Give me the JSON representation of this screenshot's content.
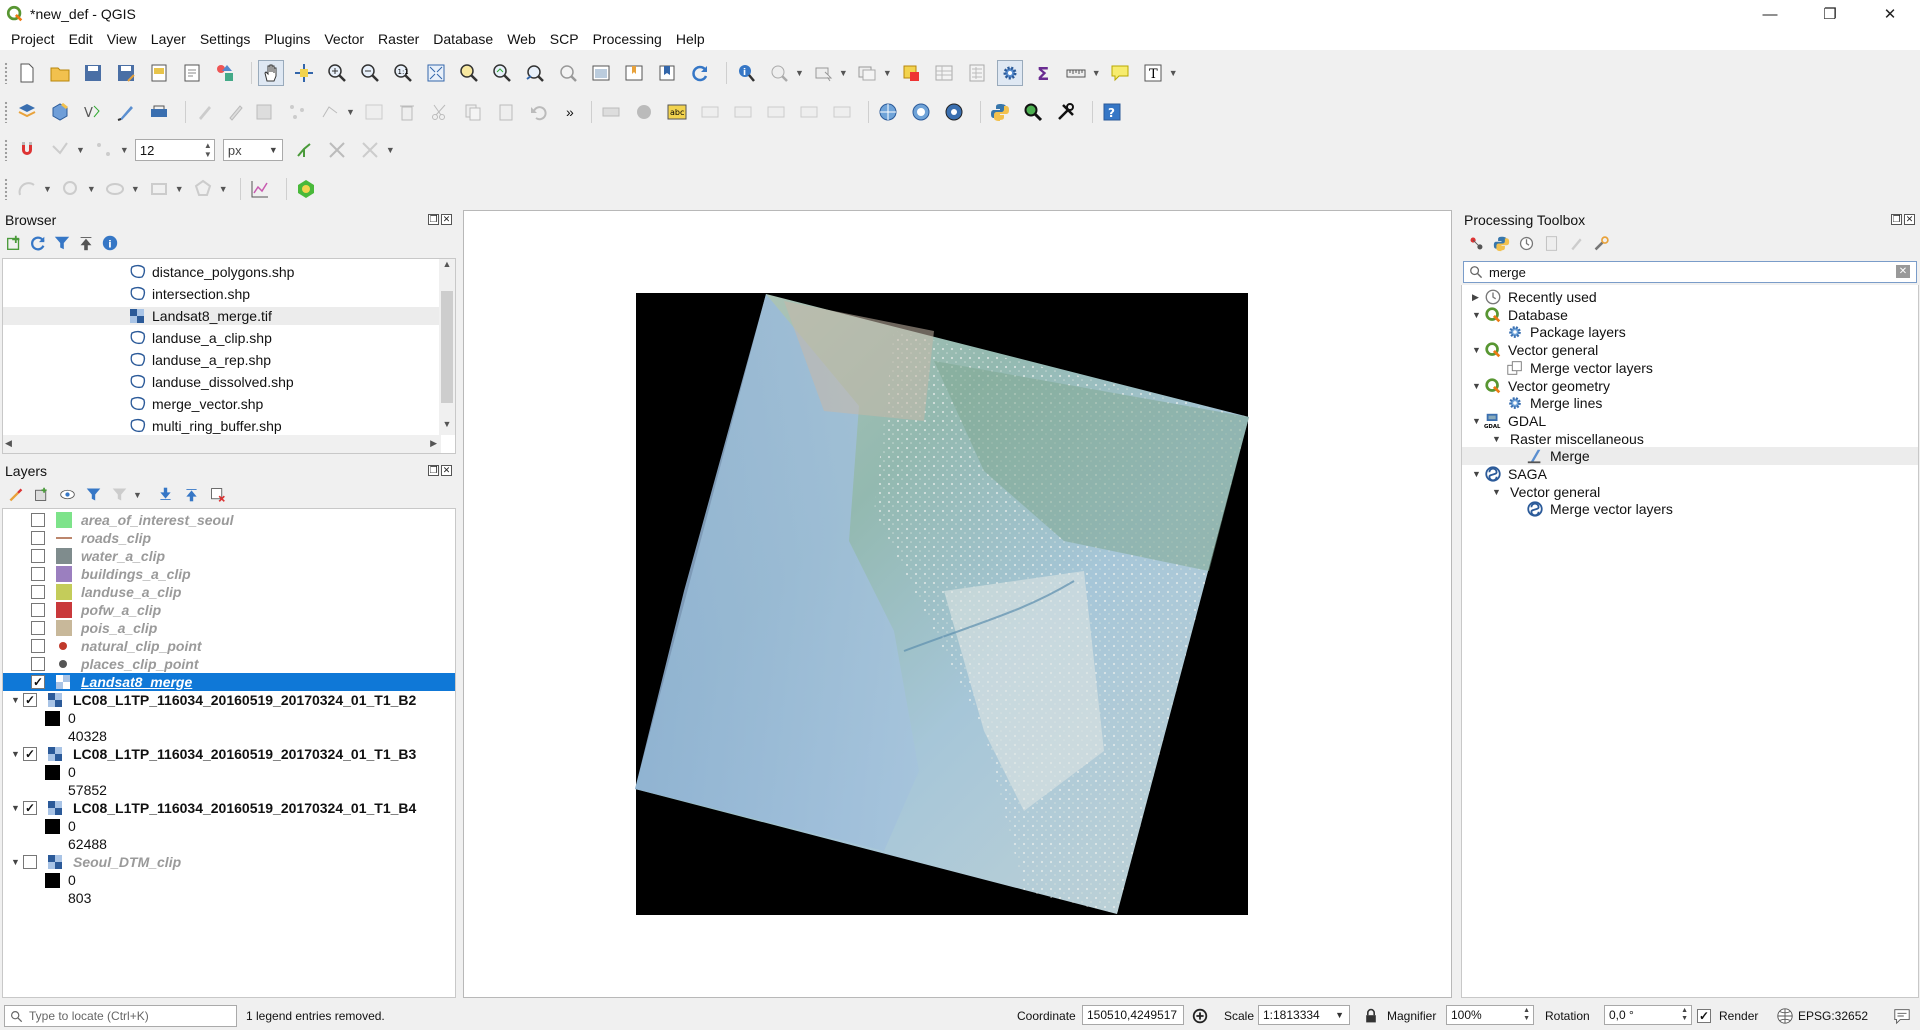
{
  "window": {
    "title": "*new_def - QGIS",
    "min": "—",
    "max": "❐",
    "close": "✕"
  },
  "menu": [
    "Project",
    "Edit",
    "View",
    "Layer",
    "Settings",
    "Plugins",
    "Vector",
    "Raster",
    "Database",
    "Web",
    "SCP",
    "Processing",
    "Help"
  ],
  "digitize": {
    "value": "12",
    "unit": "px"
  },
  "browser": {
    "title": "Browser",
    "items": [
      {
        "label": "distance_polygons.shp",
        "type": "vector"
      },
      {
        "label": "intersection.shp",
        "type": "vector"
      },
      {
        "label": "Landsat8_merge.tif",
        "type": "raster"
      },
      {
        "label": "landuse_a_clip.shp",
        "type": "vector"
      },
      {
        "label": "landuse_a_rep.shp",
        "type": "vector"
      },
      {
        "label": "landuse_dissolved.shp",
        "type": "vector"
      },
      {
        "label": "merge_vector.shp",
        "type": "vector"
      },
      {
        "label": "multi_ring_buffer.shp",
        "type": "vector"
      }
    ]
  },
  "layers": {
    "title": "Layers",
    "items": [
      {
        "name": "area_of_interest_seoul",
        "checked": false,
        "swatch": "#7de38a"
      },
      {
        "name": "roads_clip",
        "checked": false,
        "swatch": "line:#a0522d"
      },
      {
        "name": "water_a_clip",
        "checked": false,
        "swatch": "#7f8c8d"
      },
      {
        "name": "buildings_a_clip",
        "checked": false,
        "swatch": "#9b7fbf"
      },
      {
        "name": "landuse_a_clip",
        "checked": false,
        "swatch": "#c4cc5a"
      },
      {
        "name": "pofw_a_clip",
        "checked": false,
        "swatch": "#c9393b"
      },
      {
        "name": "pois_a_clip",
        "checked": false,
        "swatch": "#c8b89a"
      },
      {
        "name": "natural_clip_point",
        "checked": false,
        "swatch": "dot:#c0392b"
      },
      {
        "name": "places_clip_point",
        "checked": false,
        "swatch": "dot:#555555"
      },
      {
        "name": "Landsat8_merge",
        "checked": true,
        "selected": true
      },
      {
        "name": "LC08_L1TP_116034_20160519_20170324_01_T1_B2",
        "checked": true,
        "legend": [
          "0",
          "40328"
        ]
      },
      {
        "name": "LC08_L1TP_116034_20160519_20170324_01_T1_B3",
        "checked": true,
        "legend": [
          "0",
          "57852"
        ]
      },
      {
        "name": "LC08_L1TP_116034_20160519_20170324_01_T1_B4",
        "checked": true,
        "legend": [
          "0",
          "62488"
        ]
      },
      {
        "name": "Seoul_DTM_clip",
        "checked": false,
        "legend": [
          "0",
          "803"
        ]
      }
    ]
  },
  "processing": {
    "title": "Processing Toolbox",
    "search": "merge",
    "items": [
      {
        "label": "Recently used",
        "icon": "clock"
      },
      {
        "label": "Database",
        "icon": "qgis"
      },
      {
        "label": "Package layers",
        "icon": "gear"
      },
      {
        "label": "Vector general",
        "icon": "qgis"
      },
      {
        "label": "Merge vector layers",
        "icon": "merge"
      },
      {
        "label": "Vector geometry",
        "icon": "qgis"
      },
      {
        "label": "Merge lines",
        "icon": "gear"
      },
      {
        "label": "GDAL",
        "icon": "gdal"
      },
      {
        "label": "Raster miscellaneous",
        "icon": "none"
      },
      {
        "label": "Merge",
        "icon": "gdal-tool"
      },
      {
        "label": "SAGA",
        "icon": "saga"
      },
      {
        "label": "Vector general",
        "icon": "none"
      },
      {
        "label": "Merge vector layers",
        "icon": "saga"
      }
    ]
  },
  "status": {
    "locate_placeholder": "Type to locate (Ctrl+K)",
    "message": "1 legend entries removed.",
    "coordinate_label": "Coordinate",
    "coordinate": "150510,4249517",
    "scale_label": "Scale",
    "scale": "1:1813334",
    "magnifier_label": "Magnifier",
    "magnifier": "100%",
    "rotation_label": "Rotation",
    "rotation": "0,0 °",
    "render_label": "Render",
    "crs": "EPSG:32652"
  }
}
